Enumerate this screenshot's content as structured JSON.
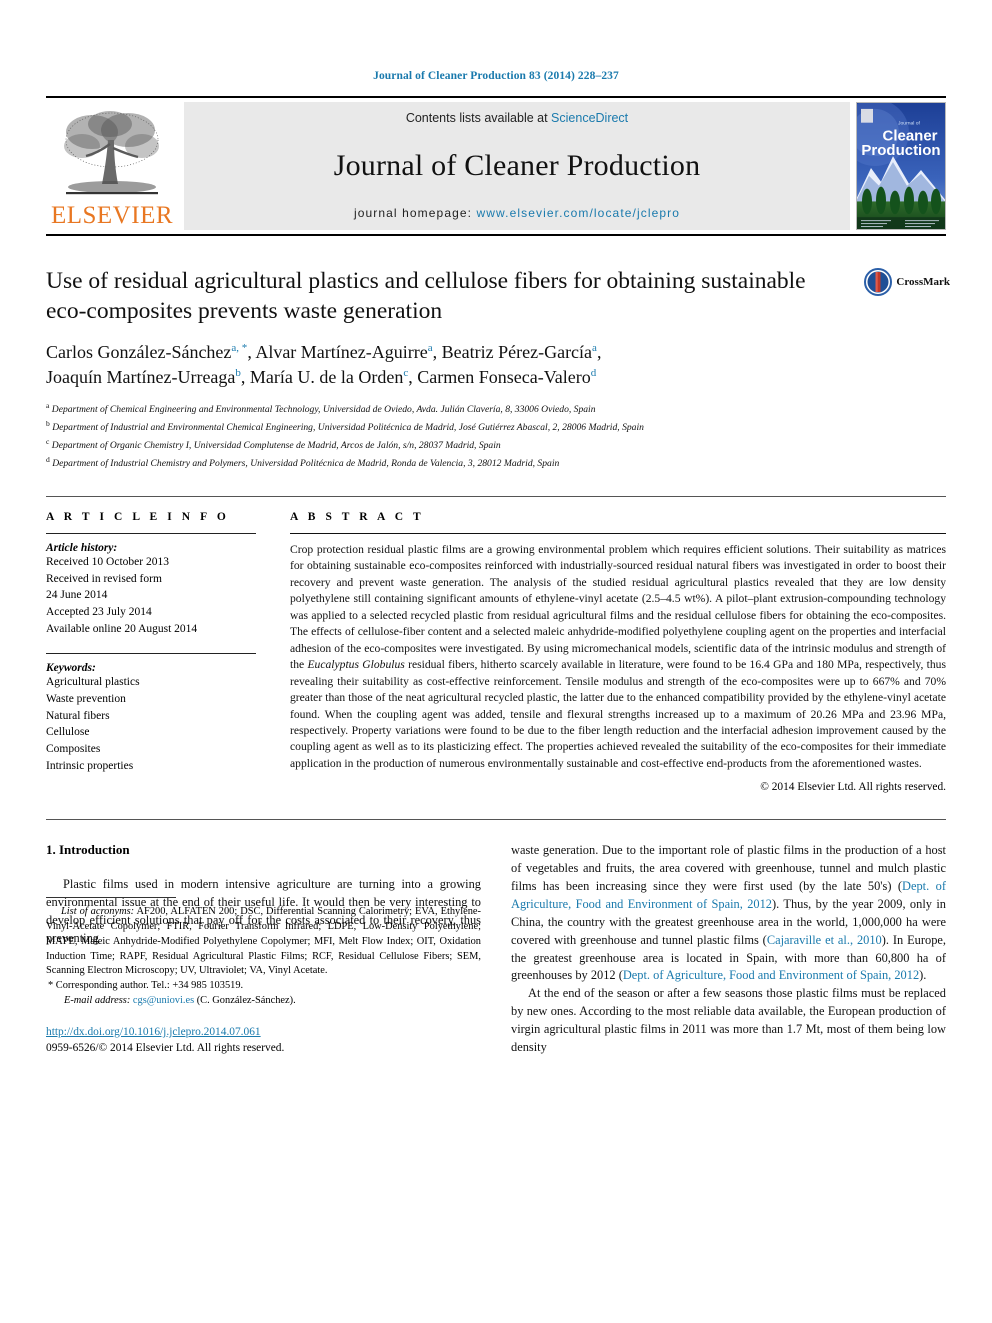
{
  "running_head": "Journal of Cleaner Production 83 (2014) 228–237",
  "masthead": {
    "publisher_name": "ELSEVIER",
    "contents_prefix": "Contents lists available at ",
    "contents_link": "ScienceDirect",
    "journal_name": "Journal of Cleaner Production",
    "homepage_prefix": "journal homepage: ",
    "homepage_url": "www.elsevier.com/locate/jclepro",
    "cover_title_small": "Journal of",
    "cover_title_line1": "Cleaner",
    "cover_title_line2": "Production"
  },
  "article": {
    "title": "Use of residual agricultural plastics and cellulose fibers for obtaining sustainable eco-composites prevents waste generation",
    "crossmark_label": "CrossMark",
    "authors_line1_a": "Carlos González-Sánchez",
    "authors_line1_a_sup": "a, *",
    "authors_line1_b": ", Alvar Martínez-Aguirre",
    "authors_line1_b_sup": "a",
    "authors_line1_c": ", Beatriz Pérez-García",
    "authors_line1_c_sup": "a",
    "authors_line1_end": ",",
    "authors_line2_a": "Joaquín Martínez-Urreaga",
    "authors_line2_a_sup": "b",
    "authors_line2_b": ", María U. de la Orden",
    "authors_line2_b_sup": "c",
    "authors_line2_c": ", Carmen Fonseca-Valero",
    "authors_line2_c_sup": "d",
    "affiliations": [
      {
        "mark": "a",
        "text": "Department of Chemical Engineering and Environmental Technology, Universidad de Oviedo, Avda. Julián Clavería, 8, 33006 Oviedo, Spain"
      },
      {
        "mark": "b",
        "text": "Department of Industrial and Environmental Chemical Engineering, Universidad Politécnica de Madrid, José Gutiérrez Abascal, 2, 28006 Madrid, Spain"
      },
      {
        "mark": "c",
        "text": "Department of Organic Chemistry I, Universidad Complutense de Madrid, Arcos de Jalón, s/n, 28037 Madrid, Spain"
      },
      {
        "mark": "d",
        "text": "Department of Industrial Chemistry and Polymers, Universidad Politécnica de Madrid, Ronda de Valencia, 3, 28012 Madrid, Spain"
      }
    ]
  },
  "article_info": {
    "heading": "A R T I C L E  I N F O",
    "history_title": "Article history:",
    "history_lines": [
      "Received 10 October 2013",
      "Received in revised form",
      "24 June 2014",
      "Accepted 23 July 2014",
      "Available online 20 August 2014"
    ],
    "keywords_title": "Keywords:",
    "keywords": [
      "Agricultural plastics",
      "Waste prevention",
      "Natural fibers",
      "Cellulose",
      "Composites",
      "Intrinsic properties"
    ]
  },
  "abstract": {
    "heading": "A B S T R A C T",
    "part1": "Crop protection residual plastic films are a growing environmental problem which requires efficient solutions. Their suitability as matrices for obtaining sustainable eco-composites reinforced with industrially-sourced residual natural fibers was investigated in order to boost their recovery and prevent waste generation. The analysis of the studied residual agricultural plastics revealed that they are low density polyethylene still containing significant amounts of ethylene-vinyl acetate (2.5–4.5 wt%). A pilot–plant extrusion-compounding technology was applied to a selected recycled plastic from residual agricultural films and the residual cellulose fibers for obtaining the eco-composites. The effects of cellulose-fiber content and a selected maleic anhydride-modified polyethylene coupling agent on the properties and interfacial adhesion of the eco-composites were investigated. By using micromechanical models, scientific data of the intrinsic modulus and strength of the ",
    "italic_species": "Eucalyptus Globulus",
    "part2": " residual fibers, hitherto scarcely available in literature, were found to be 16.4 GPa and 180 MPa, respectively, thus revealing their suitability as cost-effective reinforcement. Tensile modulus and strength of the eco-composites were up to 667% and 70% greater than those of the neat agricultural recycled plastic, the latter due to the enhanced compatibility provided by the ethylene-vinyl acetate found. When the coupling agent was added, tensile and flexural strengths increased up to a maximum of 20.26 MPa and 23.96 MPa, respectively. Property variations were found to be due to the fiber length reduction and the interfacial adhesion improvement caused by the coupling agent as well as to its plasticizing effect. The properties achieved revealed the suitability of the eco-composites for their immediate application in the production of numerous environmentally sustainable and cost-effective end-products from the aforementioned wastes.",
    "copyright": "© 2014 Elsevier Ltd. All rights reserved."
  },
  "introduction": {
    "heading": "1. Introduction",
    "left_p1": "Plastic films used in modern intensive agriculture are turning into a growing environmental issue at the end of their useful life. It would then be very interesting to develop efficient solutions that pay off for the costs associated to their recovery, thus preventing",
    "right_p1_a": "waste generation. Due to the important role of plastic films in the production of a host of vegetables and fruits, the area covered with greenhouse, tunnel and mulch plastic films has been increasing since they were first used (by the late 50's) (",
    "right_cite1": "Dept. of Agriculture, Food and Environment of Spain, 2012",
    "right_p1_b": "). Thus, by the year 2009, only in China, the country with the greatest greenhouse area in the world, 1,000,000 ha were covered with greenhouse and tunnel plastic films (",
    "right_cite2": "Cajaraville et al., 2010",
    "right_p1_c": "). In Europe, the greatest greenhouse area is located in Spain, with more than 60,800 ha of greenhouses by 2012 (",
    "right_cite3": "Dept. of Agriculture, Food and Environment of Spain, 2012",
    "right_p1_d": ").",
    "right_p2": "At the end of the season or after a few seasons those plastic films must be replaced by new ones. According to the most reliable data available, the European production of virgin agricultural plastic films in 2011 was more than 1.7 Mt, most of them being low density"
  },
  "footnotes": {
    "acronyms_title": "List of acronyms:",
    "acronyms_text": " AF200, ALFATEN 200; DSC, Differential Scanning Calorimetry; EVA, Ethylene-Vinyl-Acetate Copolymer; FTIR, Fourier Transform Infrared; LDPE, Low-Density Polyethylene; MAPE, Maleic Anhydride-Modified Polyethylene Copolymer; MFI, Melt Flow Index; OIT, Oxidation Induction Time; RAPF, Residual Agricultural Plastic Films; RCF, Residual Cellulose Fibers; SEM, Scanning Electron Microscopy; UV, Ultraviolet; VA, Vinyl Acetate.",
    "corresponding": "* Corresponding author. Tel.: +34 985 103519.",
    "email_label": "E-mail address:",
    "email": "cgs@uniovi.es",
    "email_suffix": " (C. González-Sánchez).",
    "doi": "http://dx.doi.org/10.1016/j.jclepro.2014.07.061",
    "issn_line": "0959-6526/© 2014 Elsevier Ltd. All rights reserved."
  },
  "colors": {
    "link_blue": "#1a7aad",
    "elsevier_orange": "#e87722",
    "band_grey": "#e9e9e9"
  }
}
